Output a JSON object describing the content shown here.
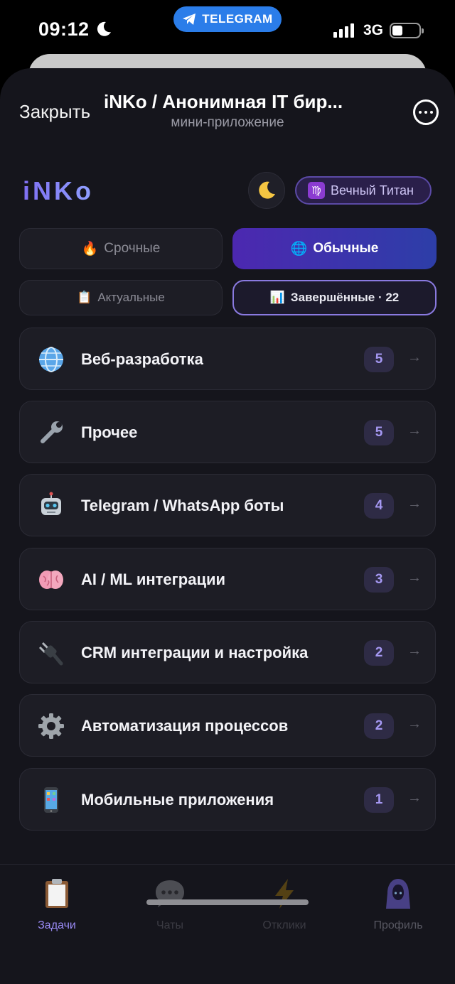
{
  "status_bar": {
    "time": "09:12",
    "network": "3G",
    "telegram_label": "TELEGRAM"
  },
  "header": {
    "close_label": "Закрыть",
    "title": "iNKo / Анонимная IT бир...",
    "subtitle": "мини-приложение",
    "more_icon": "ellipsis-icon"
  },
  "brand": {
    "logo": "iNKo",
    "theme_icon": "crescent-moon-icon",
    "rank_symbol": "♍",
    "rank_label": "Вечный Титан"
  },
  "tabs": [
    {
      "icon": "🔥",
      "label": "Срочные",
      "active": false
    },
    {
      "icon": "🌐",
      "label": "Обычные",
      "active": true
    },
    {
      "icon": "📋",
      "label": "Актуальные",
      "active": false
    },
    {
      "icon": "📊",
      "label": "Завершённые · 22",
      "active": true
    }
  ],
  "categories": [
    {
      "icon": "globe-icon",
      "name": "Веб-разработка",
      "count": "5"
    },
    {
      "icon": "wrench-icon",
      "name": "Прочее",
      "count": "5"
    },
    {
      "icon": "robot-icon",
      "name": "Telegram / WhatsApp боты",
      "count": "4"
    },
    {
      "icon": "brain-icon",
      "name": "AI / ML интеграции",
      "count": "3"
    },
    {
      "icon": "plug-icon",
      "name": "CRM интеграции и настройка",
      "count": "2"
    },
    {
      "icon": "gear-icon",
      "name": "Автоматизация процессов",
      "count": "2"
    },
    {
      "icon": "phone-icon",
      "name": "Мобильные приложения",
      "count": "1"
    }
  ],
  "arrow": "→",
  "nav": [
    {
      "icon": "clipboard-icon",
      "label": "Задачи",
      "active": true
    },
    {
      "icon": "speech-bubble-icon",
      "label": "Чаты",
      "active": false
    },
    {
      "icon": "lightning-icon",
      "label": "Отклики",
      "active": false
    },
    {
      "icon": "hooded-figure-icon",
      "label": "Профиль",
      "active": false
    }
  ],
  "colors": {
    "accent": "#8b7cf6",
    "background": "#15151c",
    "card": "#1d1d25",
    "telegram": "#2b7de9"
  }
}
